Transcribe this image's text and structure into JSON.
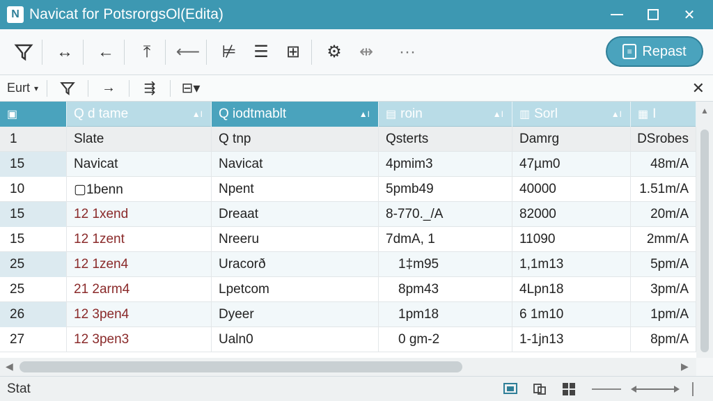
{
  "window": {
    "title": "Navicat for PotsrorgsOl(Edita)",
    "logo_letter": "N"
  },
  "toolbar": {
    "repeat_label": "Repast"
  },
  "subtoolbar": {
    "select_value": "Eurt"
  },
  "grid": {
    "columns": [
      {
        "label": "",
        "icon": "table-icon"
      },
      {
        "label": "Q d tame",
        "icon": "search-icon"
      },
      {
        "label": "Q iodtmablt",
        "icon": "search-icon"
      },
      {
        "label": "roin",
        "icon": "chart-icon"
      },
      {
        "label": "Sorl",
        "icon": "doc-icon"
      },
      {
        "label": "I",
        "icon": "calc-icon"
      }
    ],
    "subheader": [
      "1",
      "Slate",
      "Q tnp",
      "Qsterts",
      "Damrg",
      "DSrobes"
    ],
    "rows": [
      [
        "15",
        "Navicat",
        "Navicat",
        "4pmim3",
        "47µm0",
        "48m/A"
      ],
      [
        "10",
        "▢1benn",
        "Npent",
        "5pmb49",
        "40000",
        "1.51m/A"
      ],
      [
        "15",
        "12 1xend",
        "Dreaat",
        "8-770._/A",
        "82000",
        "20m/A"
      ],
      [
        "15",
        "12 1zent",
        "Nreeru",
        "7dmA, 1",
        "11090",
        "2mm/A"
      ],
      [
        "25",
        "12 1zen4",
        "Uracorð",
        "1‡m95",
        "1,1m13",
        "5pm/A"
      ],
      [
        "25",
        "21 2arm4",
        "Lpetcom",
        "8pm43",
        "4Lpn18",
        "3pm/A"
      ],
      [
        "26",
        "12 3pen4",
        "Dyeer",
        "1pm18",
        "6 1m10",
        "1pm/A"
      ],
      [
        "27",
        "12 3pen3",
        "Ualn0",
        "0 gm-2",
        "1-1jn13",
        "8pm/A"
      ]
    ]
  },
  "status": {
    "text": "Stat"
  }
}
